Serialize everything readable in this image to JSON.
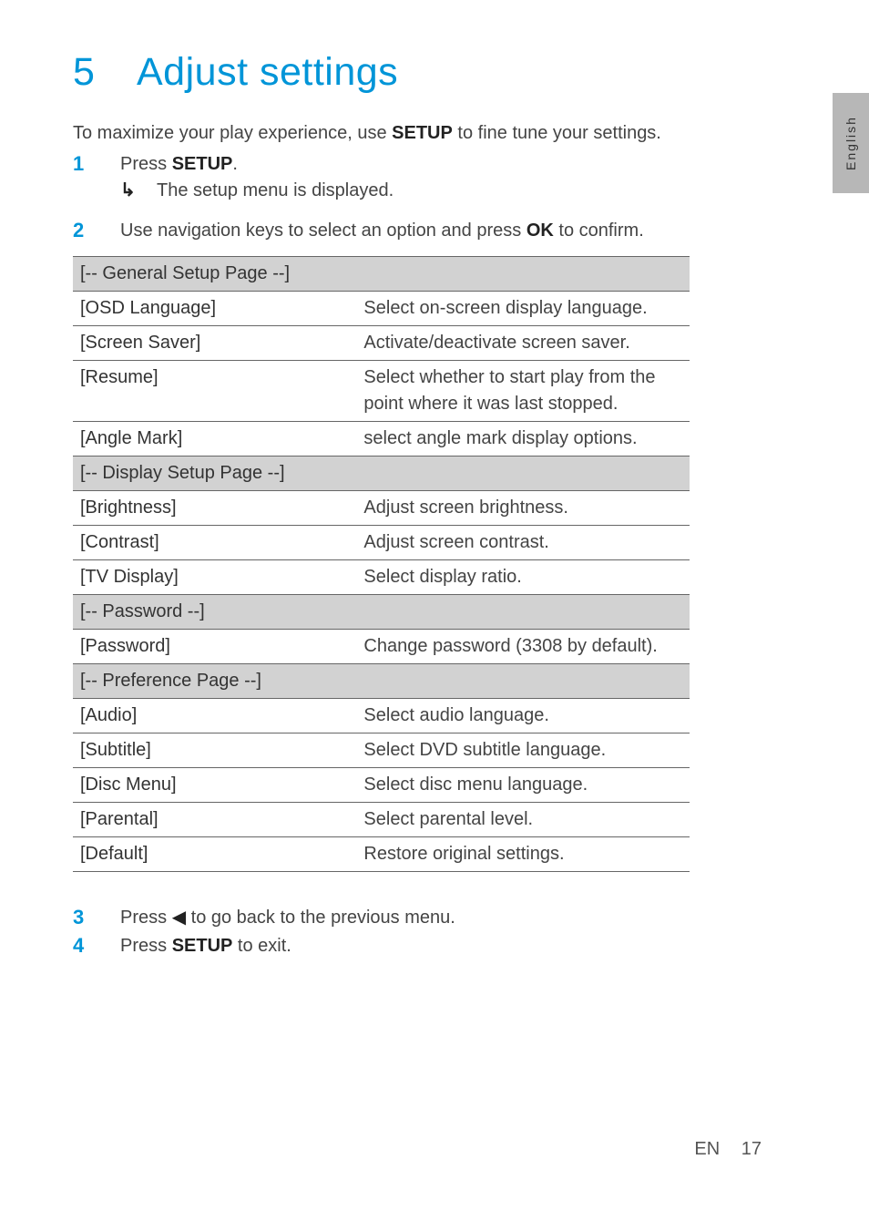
{
  "chapter_number": "5",
  "chapter_title": "Adjust settings",
  "intro_pre": "To maximize your play experience, use ",
  "intro_bold": "SETUP",
  "intro_post": " to fine tune your settings.",
  "steps": {
    "s1": {
      "num": "1",
      "pre": "Press ",
      "bold": "SETUP",
      "post": "."
    },
    "s1sub": {
      "text": "The setup menu is displayed."
    },
    "s2": {
      "num": "2",
      "pre": "Use navigation keys to select an option and press ",
      "bold": "OK",
      "post": " to confirm."
    },
    "s3": {
      "num": "3",
      "pre": "Press ",
      "icon": "◀",
      "post": " to go back to the previous menu."
    },
    "s4": {
      "num": "4",
      "pre": "Press ",
      "bold": "SETUP",
      "post": " to exit."
    }
  },
  "table": {
    "sections": [
      {
        "header": "[-- General Setup Page --]",
        "rows": [
          {
            "key": "[OSD Language]",
            "val": "Select on-screen display language."
          },
          {
            "key": "[Screen Saver]",
            "val": "Activate/deactivate screen saver."
          },
          {
            "key": "[Resume]",
            "val": "Select whether to start play from the point where it was last stopped."
          },
          {
            "key": "[Angle Mark]",
            "val": "select angle mark display options."
          }
        ]
      },
      {
        "header": "[-- Display Setup Page --]",
        "rows": [
          {
            "key": "[Brightness]",
            "val": "Adjust screen brightness."
          },
          {
            "key": "[Contrast]",
            "val": "Adjust screen contrast."
          },
          {
            "key": "[TV Display]",
            "val": "Select display ratio."
          }
        ]
      },
      {
        "header": "[-- Password --]",
        "rows": [
          {
            "key": "[Password]",
            "val": "Change password (3308 by default)."
          }
        ]
      },
      {
        "header": "[-- Preference Page --]",
        "rows": [
          {
            "key": "[Audio]",
            "val": "Select audio language."
          },
          {
            "key": "[Subtitle]",
            "val": "Select DVD subtitle language."
          },
          {
            "key": "[Disc Menu]",
            "val": "Select disc menu language."
          },
          {
            "key": "[Parental]",
            "val": "Select parental level."
          },
          {
            "key": "[Default]",
            "val": "Restore original settings."
          }
        ]
      }
    ]
  },
  "side_tab": "English",
  "footer": {
    "lang": "EN",
    "page": "17"
  },
  "left_arrow": "◀",
  "sub_arrow": "↳"
}
